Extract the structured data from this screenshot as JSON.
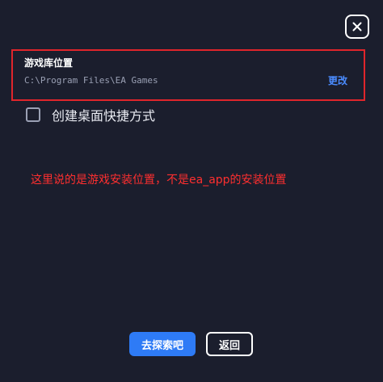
{
  "dialog": {
    "close_icon": "close-icon",
    "game_library": {
      "title": "游戏库位置",
      "path": "C:\\Program Files\\EA Games",
      "change_label": "更改"
    },
    "desktop_shortcut": {
      "label": "创建桌面快捷方式",
      "checked": false
    },
    "annotation": "这里说的是游戏安装位置，不是ea_app的安装位置",
    "buttons": {
      "explore_label": "去探索吧",
      "back_label": "返回"
    }
  },
  "colors": {
    "background": "#1b1e2d",
    "accent": "#2e7bf6",
    "link": "#4b8cff",
    "highlight_border": "#e0252b",
    "annotation": "#ff2f2f"
  }
}
